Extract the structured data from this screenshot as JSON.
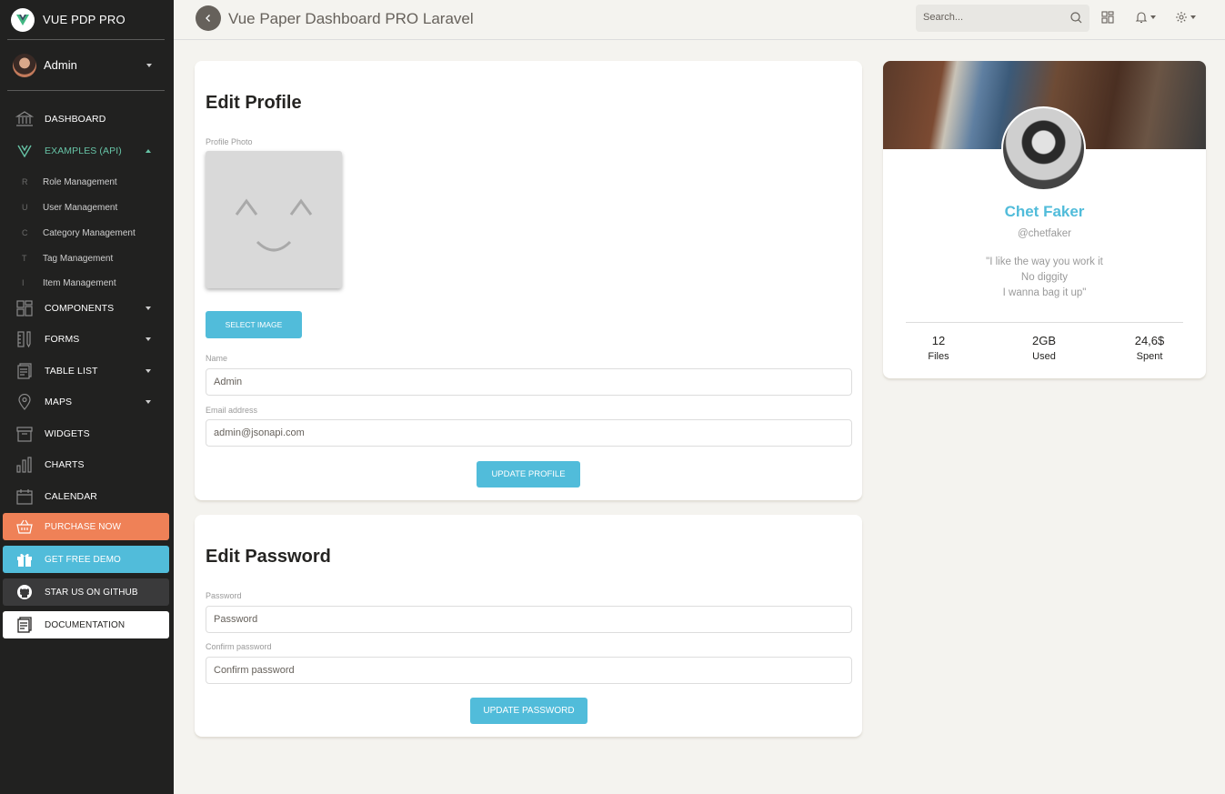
{
  "sidebar": {
    "logo_text": "VUE PDP PRO",
    "user_name": "Admin",
    "items": [
      {
        "label": "DASHBOARD"
      },
      {
        "label": "EXAMPLES (API)"
      },
      {
        "label": "COMPONENTS"
      },
      {
        "label": "FORMS"
      },
      {
        "label": "TABLE LIST"
      },
      {
        "label": "MAPS"
      },
      {
        "label": "WIDGETS"
      },
      {
        "label": "CHARTS"
      },
      {
        "label": "CALENDAR"
      }
    ],
    "sub_items": [
      {
        "letter": "R",
        "label": "Role Management"
      },
      {
        "letter": "U",
        "label": "User Management"
      },
      {
        "letter": "C",
        "label": "Category Management"
      },
      {
        "letter": "T",
        "label": "Tag Management"
      },
      {
        "letter": "I",
        "label": "Item Management"
      }
    ],
    "buttons": [
      {
        "label": "PURCHASE NOW",
        "color": "#ef8157"
      },
      {
        "label": "GET FREE DEMO",
        "color": "#51bcda"
      },
      {
        "label": "STAR US ON GITHUB",
        "color": "#3a3a3b"
      },
      {
        "label": "DOCUMENTATION",
        "color": "#ffffff"
      }
    ],
    "active_color": "#66c2a5"
  },
  "topbar": {
    "title": "Vue Paper Dashboard PRO Laravel",
    "search_placeholder": "Search..."
  },
  "edit_profile": {
    "title": "Edit Profile",
    "photo_label": "Profile Photo",
    "select_image": "SELECT IMAGE",
    "name_label": "Name",
    "name_value": "Admin",
    "email_label": "Email address",
    "email_value": "admin@jsonapi.com",
    "update_button": "UPDATE PROFILE"
  },
  "edit_password": {
    "title": "Edit Password",
    "password_label": "Password",
    "password_placeholder": "Password",
    "confirm_label": "Confirm password",
    "confirm_placeholder": "Confirm password",
    "update_button": "UPDATE PASSWORD"
  },
  "profile_card": {
    "name": "Chet Faker",
    "handle": "@chetfaker",
    "quote_lines": [
      "\"I like the way you work it",
      "No diggity",
      "I wanna bag it up\""
    ],
    "stats": [
      {
        "value": "12",
        "label": "Files"
      },
      {
        "value": "2GB",
        "label": "Used"
      },
      {
        "value": "24,6$",
        "label": "Spent"
      }
    ]
  }
}
